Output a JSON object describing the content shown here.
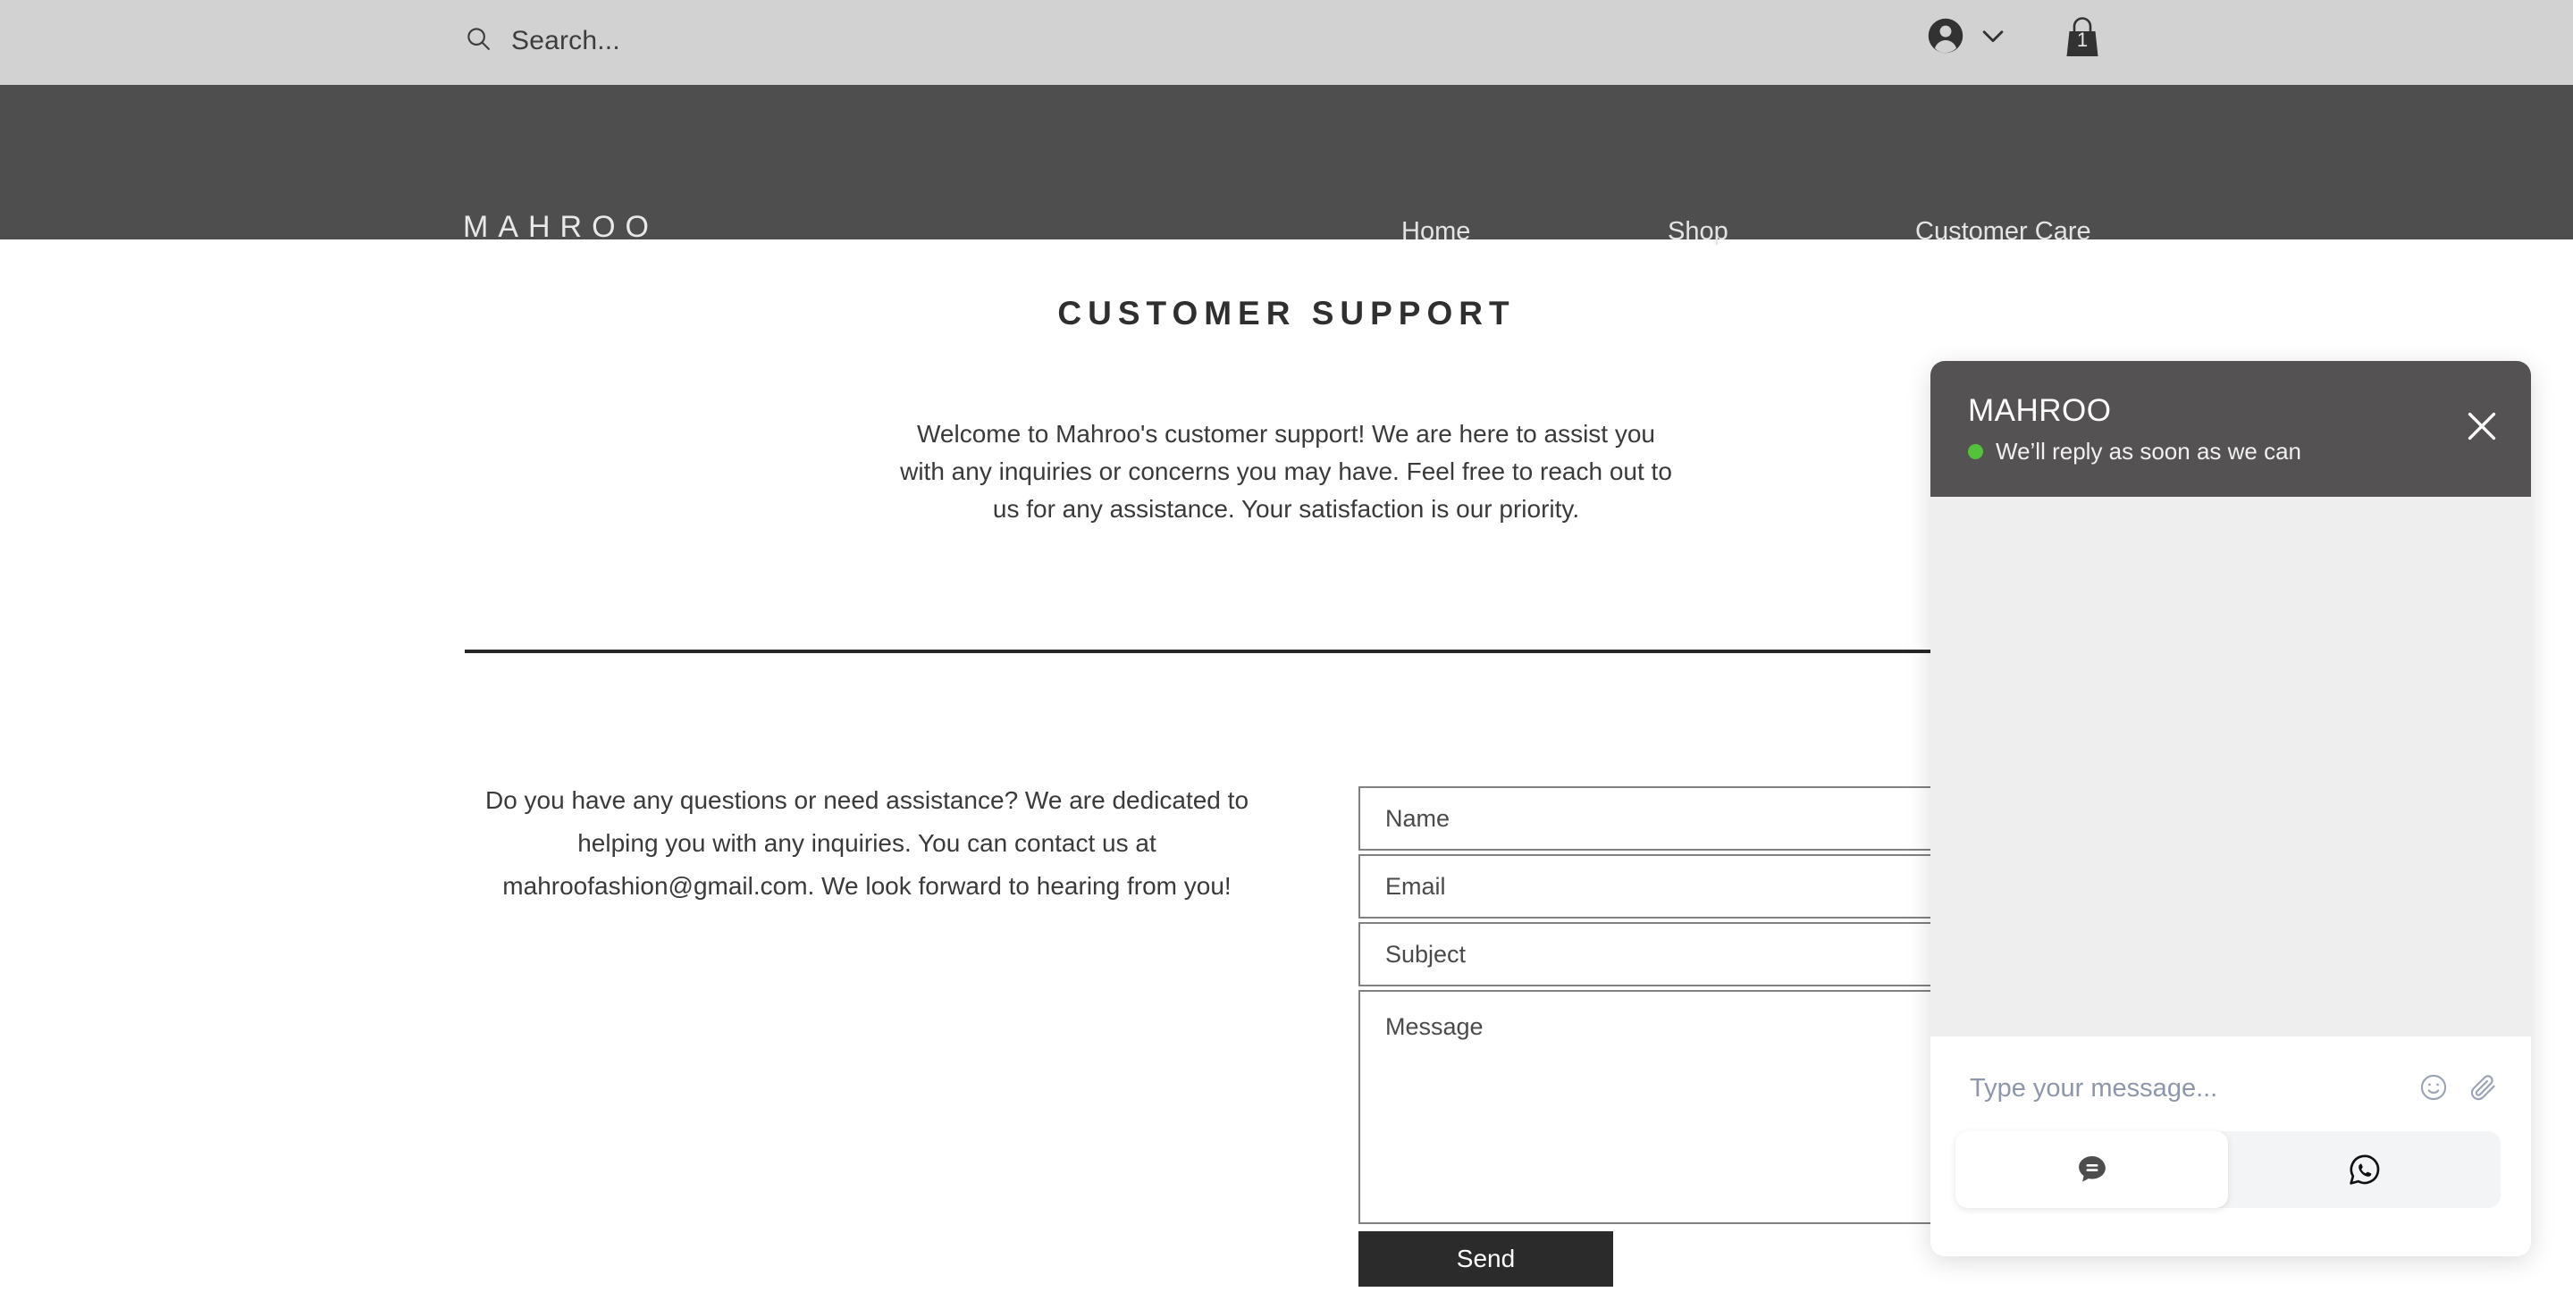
{
  "topbar": {
    "search": {
      "placeholder": "Search...",
      "icon": "search-icon"
    },
    "account": {
      "icon": "account-avatar-icon",
      "chevron": "chevron-down-icon"
    },
    "cart": {
      "icon": "shopping-bag-icon",
      "count": "1"
    }
  },
  "nav": {
    "brand": "MAHROO",
    "links": [
      {
        "label": "Home"
      },
      {
        "label": "Shop"
      },
      {
        "label": "Customer Care"
      }
    ]
  },
  "main": {
    "page_title": "CUSTOMER SUPPORT",
    "intro_paragraph": "Welcome to Mahroo's customer support! We are here to assist you with any inquiries or concerns you may have. Feel free to reach out to us for any assistance. Your satisfaction is our priority.",
    "contact_paragraph": "Do you have any questions or need assistance? We are dedicated to helping you with any inquiries. You can contact us at mahroofashion@gmail.com. We look forward to hearing from you!"
  },
  "form": {
    "name": {
      "placeholder": "Name",
      "value": ""
    },
    "email": {
      "placeholder": "Email",
      "value": ""
    },
    "subject": {
      "placeholder": "Subject",
      "value": ""
    },
    "message": {
      "placeholder": "Message",
      "value": ""
    },
    "send_label": "Send"
  },
  "chat": {
    "brand": "MAHROO",
    "status_text": "We’ll reply as soon as we can",
    "status_color": "#54c23a",
    "close_icon": "close-icon",
    "compose_placeholder": "Type your message...",
    "emoji_icon": "emoji-smiley-icon",
    "attach_icon": "paperclip-icon",
    "tabs": [
      {
        "name": "chat",
        "icon": "chat-bubble-icon",
        "active": true
      },
      {
        "name": "whatsapp",
        "icon": "whatsapp-icon",
        "active": false
      }
    ]
  },
  "colors": {
    "topbar_bg": "#d2d2d2",
    "nav_bg": "#4f4e4e",
    "chat_header_bg": "#545252",
    "chat_body_bg": "#eeeeee",
    "send_button_bg": "#2b2b2b",
    "divider": "#272727"
  }
}
